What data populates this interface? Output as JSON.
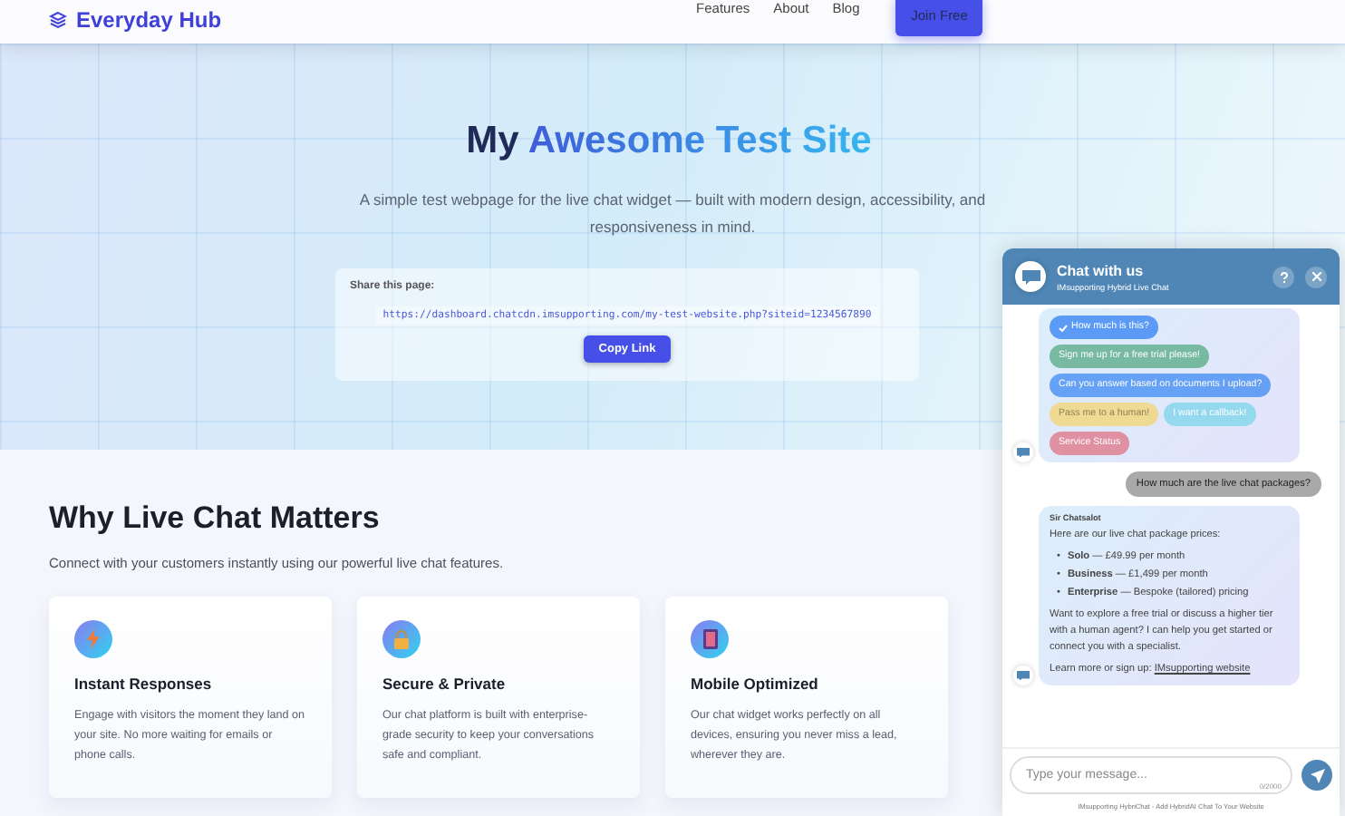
{
  "nav": {
    "brand": "Everyday Hub",
    "links": [
      "Features",
      "About",
      "Blog"
    ],
    "cta": "Join Free"
  },
  "hero": {
    "title": [
      {
        "text": "My",
        "highlight": false
      },
      {
        "text": "Awesome Test Site",
        "highlight": true
      }
    ],
    "subtitle": "A simple test webpage for the live chat widget — built with modern design, accessibility, and responsiveness in mind.",
    "share_label": "Share this page:",
    "share_url": "https://dashboard.chatcdn.imsupporting.com/my-test-website.php?siteid=1234567890",
    "copy_button": "Copy Link"
  },
  "section": {
    "title": "Why Live Chat Matters",
    "subtitle": "Connect with your customers instantly using our powerful live chat features.",
    "features": [
      {
        "kind": "bolt",
        "title": "Instant Responses",
        "text": "Engage with visitors the moment they land on your site. No more waiting for emails or phone calls."
      },
      {
        "kind": "lock",
        "title": "Secure & Private",
        "text": "Our chat platform is built with enterprise-grade security to keep your conversations safe and compliant."
      },
      {
        "kind": "phone",
        "title": "Mobile Optimized",
        "text": "Our chat widget works perfectly on all devices, ensuring you never miss a lead, wherever they are."
      }
    ]
  },
  "chat": {
    "title": "Chat with us",
    "subtitle": "IMsupporting Hybrid Live Chat",
    "quick_replies": [
      {
        "label": "How much is this?",
        "selected": true,
        "color": "#5b9bf5"
      },
      {
        "label": "Sign me up for a free trial please!",
        "selected": false,
        "color": "#6fb59a"
      },
      {
        "label": "Can you answer based on documents I upload?",
        "selected": false,
        "color": "#5b9bf5"
      },
      {
        "label": "Pass me to a human!",
        "selected": false,
        "color": "#f0d98a"
      },
      {
        "label": "I want a callback!",
        "selected": false,
        "color": "#8fd8ef"
      },
      {
        "label": "Service Status",
        "selected": false,
        "color": "#e08a9a"
      }
    ],
    "user_message": "How much are the live chat packages?",
    "bot_message": {
      "sender": "Sir Chatsalot",
      "intro": "Here are our live chat package prices:",
      "items": [
        {
          "marker": "•",
          "text": "**Solo** — £49.99 per month"
        },
        {
          "marker": "•",
          "text": "**Business** — £1,499 per month"
        },
        {
          "marker": "•",
          "text": "**Enterprise** — Bespoke (tailored) pricing"
        }
      ],
      "text": "Want to explore a free trial or discuss a higher tier with a human agent? I can help you get started or connect you with a specialist.",
      "link_prefix": "Learn more or sign up:",
      "link": "IMsupporting website"
    },
    "input_placeholder": "Type your message...",
    "counter": "0/2000",
    "footer": "IMsupporting HybriChat - Add HybridAI Chat To Your Website"
  }
}
